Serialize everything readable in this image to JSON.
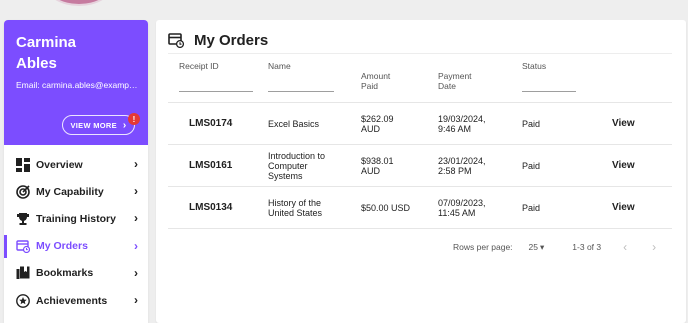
{
  "profile": {
    "name": "Carmina Ables",
    "email": "Email: carmina.ables@example.com",
    "view_more_label": "VIEW MORE",
    "alert_badge": "!"
  },
  "sidebar": {
    "items": [
      {
        "label": "Overview",
        "icon": "dashboard-icon"
      },
      {
        "label": "My Capability",
        "icon": "target-icon"
      },
      {
        "label": "Training History",
        "icon": "trophy-icon"
      },
      {
        "label": "My Orders",
        "icon": "orders-icon",
        "active": true
      },
      {
        "label": "Bookmarks",
        "icon": "bookmarks-icon"
      },
      {
        "label": "Achievements",
        "icon": "star-icon"
      }
    ]
  },
  "main": {
    "title": "My Orders",
    "icon": "orders-icon",
    "columns": [
      "Receipt ID",
      "Name",
      "Amount Paid",
      "Payment Date",
      "Status"
    ],
    "rows": [
      {
        "receipt": "LMS0174",
        "name": "Excel Basics",
        "amount": "$262.09 AUD",
        "date": "19/03/2024, 9:46 AM",
        "status": "Paid",
        "action": "View"
      },
      {
        "receipt": "LMS0161",
        "name": "Introduction to Computer Systems",
        "amount": "$938.01 AUD",
        "date": "23/01/2024, 2:58 PM",
        "status": "Paid",
        "action": "View"
      },
      {
        "receipt": "LMS0134",
        "name": "History of the United States",
        "amount": "$50.00 USD",
        "date": "07/09/2023, 11:45 AM",
        "status": "Paid",
        "action": "View"
      }
    ],
    "pagination": {
      "rows_per_page_label": "Rows per page:",
      "rows_per_page": "25",
      "range": "1-3 of 3"
    }
  },
  "colors": {
    "accent": "#7c4dff",
    "badge": "#e53935"
  }
}
